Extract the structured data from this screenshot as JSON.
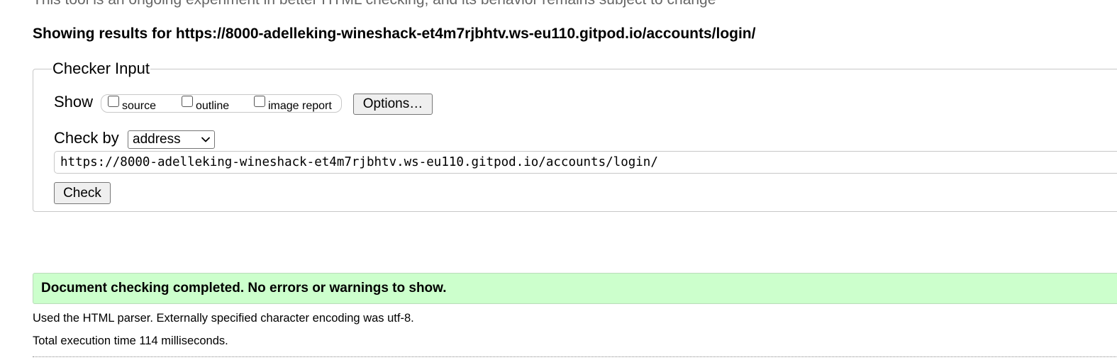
{
  "intro": {
    "subtitle": "This tool is an ongoing experiment in better HTML checking, and its behavior remains subject to change"
  },
  "results": {
    "heading": "Showing results for https://8000-adelleking-wineshack-et4m7rjbhtv.ws-eu110.gitpod.io/accounts/login/"
  },
  "checker": {
    "legend": "Checker Input",
    "show_label": "Show",
    "show_options": [
      {
        "label": "source",
        "checked": false
      },
      {
        "label": "outline",
        "checked": false
      },
      {
        "label": "image report",
        "checked": false
      }
    ],
    "options_button": "Options…",
    "check_by_label": "Check by",
    "check_by_selected": "address",
    "url_value": "https://8000-adelleking-wineshack-et4m7rjbhtv.ws-eu110.gitpod.io/accounts/login/",
    "check_button": "Check"
  },
  "status": {
    "message": "Document checking completed. No errors or warnings to show.",
    "color": "#ccffcc"
  },
  "details": {
    "parser_info": "Used the HTML parser. Externally specified character encoding was utf-8.",
    "execution_time": "Total execution time 114 milliseconds."
  }
}
